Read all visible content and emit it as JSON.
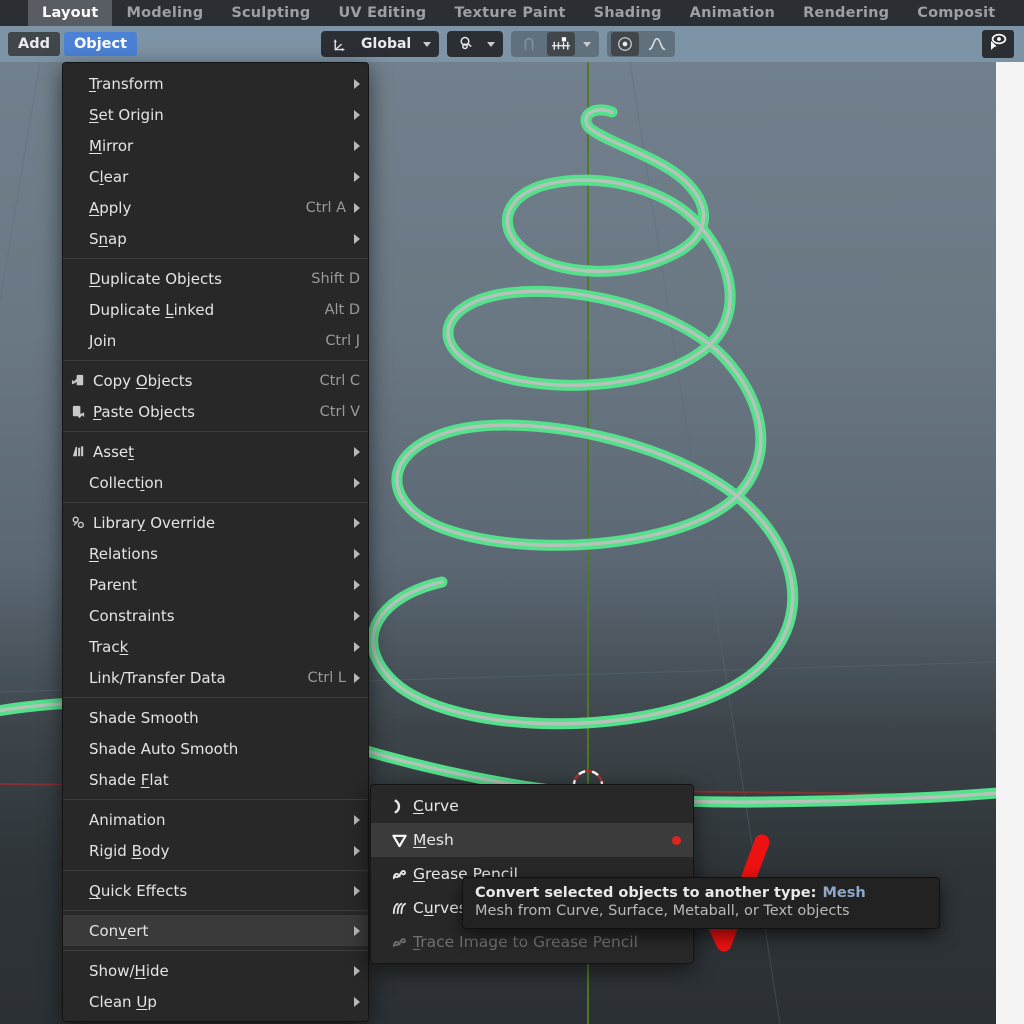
{
  "workspace_tabs": [
    {
      "label": "Layout",
      "active": true
    },
    {
      "label": "Modeling",
      "active": false
    },
    {
      "label": "Sculpting",
      "active": false
    },
    {
      "label": "UV Editing",
      "active": false
    },
    {
      "label": "Texture Paint",
      "active": false
    },
    {
      "label": "Shading",
      "active": false
    },
    {
      "label": "Animation",
      "active": false
    },
    {
      "label": "Rendering",
      "active": false
    },
    {
      "label": "Composit",
      "active": false
    }
  ],
  "viewport_header": {
    "add_label": "Add",
    "object_label": "Object",
    "orientation_value": "Global",
    "orientation_icon": "transform-orientation-icon",
    "snap_icon": "magnet-icon",
    "snap_dropdown_icon": "chevron-down-icon",
    "proportional_icon": "proportional-edit-icon",
    "proportional_falloff_icon": "falloff-curve-icon",
    "pivot_icon": "pivot-point-icon",
    "visibility_icon": "eye-cursor-icon"
  },
  "object_menu": {
    "items": [
      {
        "label": "Transform",
        "accel": "T",
        "shortcut": "",
        "arrow": true,
        "icon": null,
        "sep_after": false
      },
      {
        "label": "Set Origin",
        "accel": "S",
        "shortcut": "",
        "arrow": true,
        "icon": null,
        "sep_after": false
      },
      {
        "label": "Mirror",
        "accel": "M",
        "shortcut": "",
        "arrow": true,
        "icon": null,
        "sep_after": false
      },
      {
        "label": "Clear",
        "accel": "l",
        "shortcut": "",
        "arrow": true,
        "icon": null,
        "sep_after": false
      },
      {
        "label": "Apply",
        "accel": "A",
        "shortcut": "Ctrl A",
        "arrow": true,
        "icon": null,
        "sep_after": false
      },
      {
        "label": "Snap",
        "accel": "n",
        "shortcut": "",
        "arrow": true,
        "icon": null,
        "sep_after": true
      },
      {
        "label": "Duplicate Objects",
        "accel": "D",
        "shortcut": "Shift D",
        "arrow": false,
        "icon": null,
        "sep_after": false
      },
      {
        "label": "Duplicate Linked",
        "accel": "L",
        "shortcut": "Alt D",
        "arrow": false,
        "icon": null,
        "sep_after": false
      },
      {
        "label": "Join",
        "accel": "J",
        "shortcut": "Ctrl J",
        "arrow": false,
        "icon": null,
        "sep_after": true
      },
      {
        "label": "Copy Objects",
        "accel": "O",
        "shortcut": "Ctrl C",
        "arrow": false,
        "icon": "copy-icon",
        "sep_after": false
      },
      {
        "label": "Paste Objects",
        "accel": "P",
        "shortcut": "Ctrl V",
        "arrow": false,
        "icon": "paste-icon",
        "sep_after": true
      },
      {
        "label": "Asset",
        "accel": "t",
        "shortcut": "",
        "arrow": true,
        "icon": "asset-icon",
        "sep_after": false
      },
      {
        "label": "Collection",
        "accel": "i",
        "shortcut": "",
        "arrow": true,
        "icon": null,
        "sep_after": true
      },
      {
        "label": "Library Override",
        "accel": "y",
        "shortcut": "",
        "arrow": true,
        "icon": "library-override-icon",
        "sep_after": false
      },
      {
        "label": "Relations",
        "accel": "R",
        "shortcut": "",
        "arrow": true,
        "icon": null,
        "sep_after": false
      },
      {
        "label": "Parent",
        "accel": "",
        "shortcut": "",
        "arrow": true,
        "icon": null,
        "sep_after": false
      },
      {
        "label": "Constraints",
        "accel": "",
        "shortcut": "",
        "arrow": true,
        "icon": null,
        "sep_after": false
      },
      {
        "label": "Track",
        "accel": "k",
        "shortcut": "",
        "arrow": true,
        "icon": null,
        "sep_after": false
      },
      {
        "label": "Link/Transfer Data",
        "accel": "",
        "shortcut": "Ctrl L",
        "arrow": true,
        "icon": null,
        "sep_after": true
      },
      {
        "label": "Shade Smooth",
        "accel": "",
        "shortcut": "",
        "arrow": false,
        "icon": null,
        "sep_after": false
      },
      {
        "label": "Shade Auto Smooth",
        "accel": "",
        "shortcut": "",
        "arrow": false,
        "icon": null,
        "sep_after": false
      },
      {
        "label": "Shade Flat",
        "accel": "F",
        "shortcut": "",
        "arrow": false,
        "icon": null,
        "sep_after": true
      },
      {
        "label": "Animation",
        "accel": "",
        "shortcut": "",
        "arrow": true,
        "icon": null,
        "sep_after": false
      },
      {
        "label": "Rigid Body",
        "accel": "B",
        "shortcut": "",
        "arrow": true,
        "icon": null,
        "sep_after": true
      },
      {
        "label": "Quick Effects",
        "accel": "Q",
        "shortcut": "",
        "arrow": true,
        "icon": null,
        "sep_after": true
      },
      {
        "label": "Convert",
        "accel": "v",
        "shortcut": "",
        "arrow": true,
        "icon": null,
        "sep_after": true,
        "highlighted": true
      },
      {
        "label": "Show/Hide",
        "accel": "H",
        "shortcut": "",
        "arrow": true,
        "icon": null,
        "sep_after": false
      },
      {
        "label": "Clean Up",
        "accel": "U",
        "shortcut": "",
        "arrow": true,
        "icon": null,
        "sep_after": false
      }
    ]
  },
  "convert_submenu": {
    "items": [
      {
        "label": "Curve",
        "accel": "C",
        "icon": "curve-icon",
        "highlighted": false,
        "disabled": false,
        "marker": false
      },
      {
        "label": "Mesh",
        "accel": "M",
        "icon": "mesh-triangle-icon",
        "highlighted": true,
        "disabled": false,
        "marker": true
      },
      {
        "label": "Grease Pencil",
        "accel": "G",
        "icon": "grease-pencil-icon",
        "highlighted": false,
        "disabled": false,
        "marker": false
      },
      {
        "label": "Curves",
        "accel": "u",
        "icon": "curves-icon",
        "highlighted": false,
        "disabled": false,
        "marker": false
      },
      {
        "label": "Trace Image to Grease Pencil",
        "accel": "T",
        "icon": "trace-image-icon",
        "highlighted": false,
        "disabled": true,
        "marker": false
      }
    ]
  },
  "tooltip": {
    "line1": "Convert selected objects to another type:",
    "value": "Mesh",
    "line2": "Mesh from Curve, Surface, Metaball, or Text objects"
  },
  "viewport_scene": {
    "object_name": "spiral-curve",
    "object_type": "curve",
    "selection_color": "#55e08c",
    "wire_core_color": "#b7c2bb",
    "z_axis_color": "#4e7a22",
    "x_axis_color": "#9a3535",
    "background_top": "#71808c",
    "background_bottom": "#2b3034",
    "cursor_name": "3d-cursor"
  },
  "annotation": {
    "name": "red-check-mark",
    "color": "#ee1111"
  }
}
